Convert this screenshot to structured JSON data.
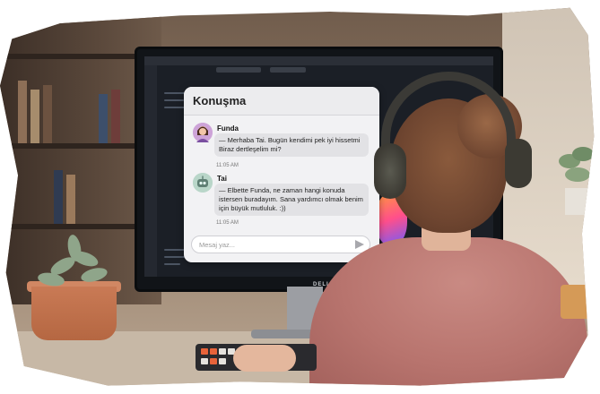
{
  "chat": {
    "title": "Konuşma",
    "messages": [
      {
        "sender": "Funda",
        "text": "— Merhaba Tai. Bugün kendimi pek iyi hissetmi Biraz dertleşelim mi?",
        "time": "11:05 AM",
        "avatar": "woman-avatar-icon"
      },
      {
        "sender": "Tai",
        "text": "— Elbette Funda, ne zaman hangi konuda istersen buradayım. Sana yardımcı olmak benim için büyük mutluluk. :))",
        "time": "11:05 AM",
        "avatar": "robot-avatar-icon"
      }
    ],
    "input_placeholder": "Mesaj yaz...",
    "send_icon": "send-icon"
  },
  "monitor": {
    "brand": "DELL"
  },
  "colors": {
    "panel": "#f2f2f4",
    "bubble": "#e2e2e5",
    "sweater": "#b8746e"
  }
}
